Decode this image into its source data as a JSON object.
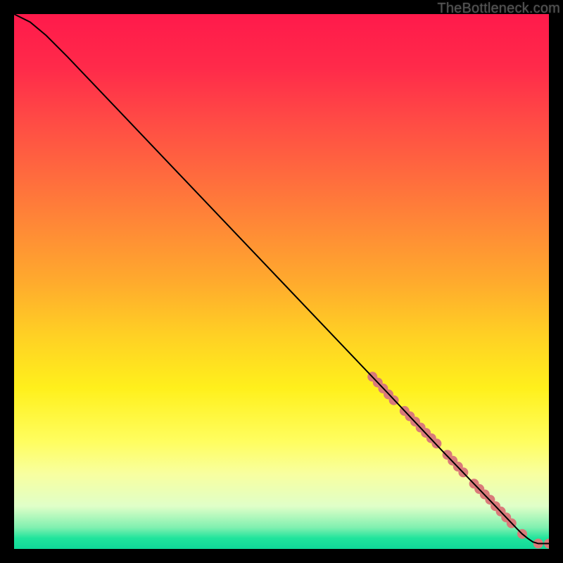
{
  "watermark": "TheBottleneck.com",
  "chart_data": {
    "type": "line",
    "title": "",
    "xlabel": "",
    "ylabel": "",
    "xlim": [
      0,
      100
    ],
    "ylim": [
      0,
      100
    ],
    "grid": false,
    "legend": false,
    "series": [
      {
        "name": "curve",
        "x": [
          0,
          3,
          6,
          10,
          20,
          30,
          40,
          50,
          60,
          70,
          75,
          80,
          85,
          90,
          92,
          94,
          95,
          96,
          97,
          98,
          100
        ],
        "y": [
          100,
          98.5,
          96,
          92,
          81.5,
          71,
          60.5,
          50,
          39.5,
          29,
          23.7,
          18.4,
          13.2,
          8,
          5.9,
          3.8,
          2.8,
          2,
          1.3,
          1,
          1
        ],
        "stroke": "#000000",
        "width": 2
      }
    ],
    "markers": {
      "name": "points",
      "color": "#d97a7a",
      "radius": 7,
      "x": [
        67,
        68,
        69,
        70,
        71,
        73,
        74,
        75,
        76,
        77,
        78,
        79,
        81,
        82,
        83,
        84,
        86,
        87,
        88,
        89,
        90,
        91,
        92,
        93,
        95,
        98,
        100
      ],
      "y": [
        32.2,
        31.1,
        30.0,
        28.9,
        27.8,
        25.8,
        24.8,
        23.8,
        22.7,
        21.7,
        20.7,
        19.7,
        17.6,
        16.5,
        15.4,
        14.3,
        12.2,
        11.2,
        10.2,
        9.2,
        8.0,
        7.0,
        5.9,
        4.8,
        2.8,
        1.0,
        1.0
      ]
    }
  }
}
